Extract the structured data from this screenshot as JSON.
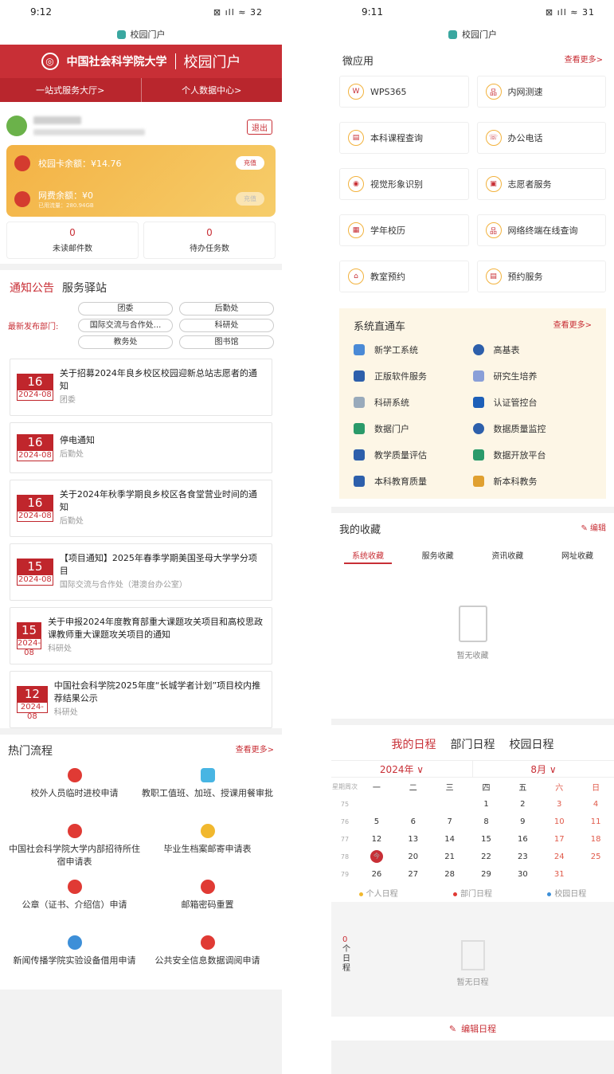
{
  "left": {
    "time": "9:12",
    "status_icons": "⊠ ıll ≈ 32",
    "url": "校园门户",
    "banner_school": "中国社会科学院大学",
    "banner_portal": "校园门户",
    "nav": [
      "一站式服务大厅>",
      "个人数据中心>"
    ],
    "logout": "退出",
    "card_label": "校园卡余额：¥14.76",
    "card_btn": "充值",
    "net_label": "网费余额：¥0",
    "net_used": "已用流量：280.94GB",
    "net_btn": "充值",
    "mail_count": "0",
    "mail_label": "未读邮件数",
    "task_count": "0",
    "task_label": "待办任务数",
    "tab_notice": "通知公告",
    "tab_service": "服务驿站",
    "dept_label": "最新发布部门:",
    "depts": [
      "团委",
      "后勤处",
      "国际交流与合作处...",
      "科研处",
      "教务处",
      "图书馆"
    ],
    "notices": [
      {
        "day": "16",
        "month": "2024-08",
        "title": "关于招募2024年良乡校区校园迎新总站志愿者的通知",
        "dept": "团委"
      },
      {
        "day": "16",
        "month": "2024-08",
        "title": "停电通知",
        "dept": "后勤处"
      },
      {
        "day": "16",
        "month": "2024-08",
        "title": "关于2024年秋季学期良乡校区各食堂营业时间的通知",
        "dept": "后勤处"
      },
      {
        "day": "15",
        "month": "2024-08",
        "title": "【项目通知】2025年春季学期美国圣母大学学分项目",
        "dept": "国际交流与合作处（港澳台办公室）"
      },
      {
        "day": "15",
        "month": "2024-08",
        "title": "关于申报2024年度教育部重大课题攻关项目和高校思政课教师重大课题攻关项目的通知",
        "dept": "科研处"
      },
      {
        "day": "12",
        "month": "2024-08",
        "title": "中国社会科学院2025年度“长城学者计划”项目校内推荐结果公示",
        "dept": "科研处"
      }
    ],
    "hot_title": "热门流程",
    "hot_more": "查看更多>",
    "hot": [
      "校外人员临时进校申请",
      "教职工值班、加班、授课用餐审批",
      "中国社会科学院大学内部招待所住宿申请表",
      "毕业生档案邮寄申请表",
      "公章（证书、介绍信）申请",
      "邮箱密码重置",
      "新闻传播学院实验设备借用申请",
      "公共安全信息数据调阅申请"
    ]
  },
  "right": {
    "time": "9:11",
    "status_icons": "⊠ ıll ≈ 31",
    "url": "校园门户",
    "micro_title": "微应用",
    "micro_more": "查看更多>",
    "micro": [
      "WPS365",
      "内网测速",
      "本科课程查询",
      "办公电话",
      "视觉形象识别",
      "志愿者服务",
      "学年校历",
      "网络终端在线查询",
      "教室预约",
      "预约服务"
    ],
    "sys_title": "系统直通车",
    "sys_more": "查看更多>",
    "sys": [
      "新学工系统",
      "高基表",
      "正版软件服务",
      "研究生培养",
      "科研系统",
      "认证管控台",
      "数据门户",
      "数据质量监控",
      "教学质量评估",
      "数据开放平台",
      "本科教育质量",
      "新本科教务"
    ],
    "fav_title": "我的收藏",
    "fav_edit": "编辑",
    "fav_tabs": [
      "系统收藏",
      "服务收藏",
      "资讯收藏",
      "网址收藏"
    ],
    "fav_empty": "暂无收藏",
    "sched_tabs": [
      "我的日程",
      "部门日程",
      "校园日程"
    ],
    "year": "2024年 ∨",
    "month": "8月 ∨",
    "week_header": [
      "星期周次",
      "一",
      "二",
      "三",
      "四",
      "五",
      "六",
      "日"
    ],
    "weeks": [
      [
        "75",
        "",
        "",
        "",
        "1",
        "2",
        "3",
        "4"
      ],
      [
        "76",
        "5",
        "6",
        "7",
        "8",
        "9",
        "10",
        "11"
      ],
      [
        "77",
        "12",
        "13",
        "14",
        "15",
        "16",
        "17",
        "18"
      ],
      [
        "78",
        "今",
        "20",
        "21",
        "22",
        "23",
        "24",
        "25"
      ],
      [
        "79",
        "26",
        "27",
        "28",
        "29",
        "30",
        "31",
        ""
      ]
    ],
    "legend": [
      "个人日程",
      "部门日程",
      "校园日程"
    ],
    "zero_count": "0",
    "zero_label": "个日程",
    "sched_empty": "暂无日程",
    "sched_edit": "编辑日程"
  }
}
